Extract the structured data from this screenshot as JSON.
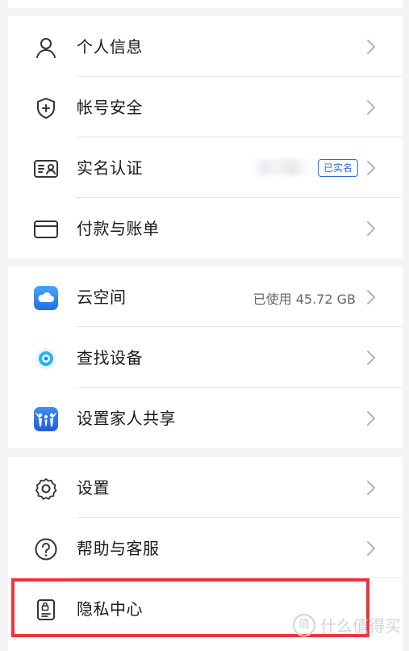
{
  "sections": [
    {
      "items": [
        {
          "label": "个人信息",
          "icon": "person-icon"
        },
        {
          "label": "帐号安全",
          "icon": "shield-icon"
        },
        {
          "label": "实名认证",
          "icon": "id-card-icon",
          "badge": "已实名"
        },
        {
          "label": "付款与账单",
          "icon": "card-icon"
        }
      ]
    },
    {
      "items": [
        {
          "label": "云空间",
          "icon": "cloud-icon",
          "value": "已使用 45.72 GB"
        },
        {
          "label": "查找设备",
          "icon": "find-device-icon"
        },
        {
          "label": "设置家人共享",
          "icon": "family-share-icon"
        }
      ]
    },
    {
      "items": [
        {
          "label": "设置",
          "icon": "gear-icon"
        },
        {
          "label": "帮助与客服",
          "icon": "help-icon"
        },
        {
          "label": "隐私中心",
          "icon": "privacy-icon"
        }
      ]
    }
  ],
  "watermark": {
    "text": "什么值得买",
    "seal": "值"
  },
  "colors": {
    "accent": "#2a6fdc",
    "highlight": "#f0323c",
    "background": "#f1f3f5"
  }
}
